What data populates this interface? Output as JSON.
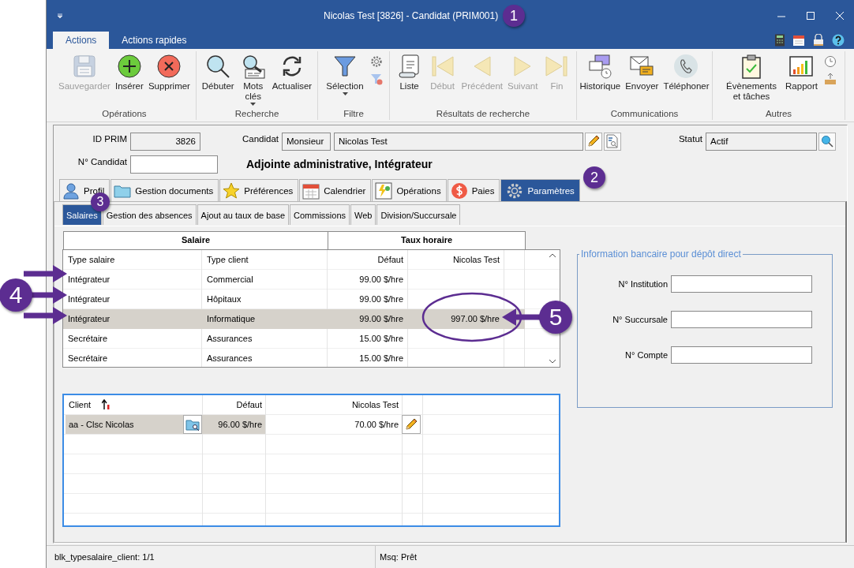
{
  "window": {
    "title": "Nicolas Test [3826] - Candidat (PRIM001)"
  },
  "ribbon": {
    "tabs": [
      {
        "label": "Actions",
        "selected": true
      },
      {
        "label": "Actions rapides",
        "selected": false
      }
    ],
    "groups": [
      {
        "label": "Opérations",
        "buttons": [
          {
            "label": "Sauvegarder",
            "disabled": true,
            "dropdown": false
          },
          {
            "label": "Insérer",
            "disabled": false,
            "dropdown": false
          },
          {
            "label": "Supprimer",
            "disabled": false,
            "dropdown": false
          }
        ]
      },
      {
        "label": "Recherche",
        "buttons": [
          {
            "label": "Débuter",
            "disabled": false,
            "dropdown": false
          },
          {
            "label": "Mots clés",
            "disabled": false,
            "dropdown": true
          },
          {
            "label": "Actualiser",
            "disabled": false,
            "dropdown": false
          }
        ]
      },
      {
        "label": "Filtre",
        "buttons": [
          {
            "label": "Sélection",
            "disabled": false,
            "dropdown": true
          }
        ]
      },
      {
        "label": "Résultats de recherche",
        "buttons": [
          {
            "label": "Liste",
            "disabled": false,
            "dropdown": false
          },
          {
            "label": "Début",
            "disabled": true,
            "dropdown": false
          },
          {
            "label": "Précédent",
            "disabled": true,
            "dropdown": false
          },
          {
            "label": "Suivant",
            "disabled": true,
            "dropdown": false
          },
          {
            "label": "Fin",
            "disabled": true,
            "dropdown": false
          }
        ]
      },
      {
        "label": "Communications",
        "buttons": [
          {
            "label": "Historique",
            "disabled": false,
            "dropdown": false
          },
          {
            "label": "Envoyer",
            "disabled": false,
            "dropdown": false
          },
          {
            "label": "Téléphoner",
            "disabled": false,
            "dropdown": false
          }
        ]
      },
      {
        "label": "Autres",
        "buttons": [
          {
            "label": "Évènements et tâches",
            "disabled": false,
            "dropdown": false
          },
          {
            "label": "Rapport",
            "disabled": false,
            "dropdown": false
          }
        ]
      }
    ]
  },
  "form": {
    "id_prim": {
      "label": "ID PRIM",
      "value": "3826"
    },
    "candidat": {
      "label": "Candidat",
      "title": "Monsieur",
      "name": "Nicolas Test"
    },
    "statut": {
      "label": "Statut",
      "value": "Actif"
    },
    "numero": {
      "label": "N° Candidat"
    },
    "heading": "Adjointe administrative, Intégrateur"
  },
  "tabs": [
    {
      "label": "Profil",
      "selected": false
    },
    {
      "label": "Gestion documents",
      "selected": false
    },
    {
      "label": "Préférences",
      "selected": false
    },
    {
      "label": "Calendrier",
      "selected": false
    },
    {
      "label": "Opérations",
      "selected": false
    },
    {
      "label": "Paies",
      "selected": false
    },
    {
      "label": "Paramètres",
      "selected": true
    }
  ],
  "subtabs": [
    {
      "label": "Salaires",
      "selected": true
    },
    {
      "label": "Gestion des absences",
      "selected": false
    },
    {
      "label": "Ajout au taux de base",
      "selected": false
    },
    {
      "label": "Commissions",
      "selected": false
    },
    {
      "label": "Web",
      "selected": false
    },
    {
      "label": "Division/Succursale",
      "selected": false
    }
  ],
  "salary_table": {
    "groups": [
      "Salaire",
      "Taux horaire"
    ],
    "columns": [
      "Type salaire",
      "Type client",
      "Défaut",
      "Nicolas Test"
    ],
    "rows": [
      {
        "type_salaire": "Intégrateur",
        "type_client": "Commercial",
        "defaut": "99.00 $/hre",
        "selected": false
      },
      {
        "type_salaire": "Intégrateur",
        "type_client": "Hôpitaux",
        "defaut": "99.00 $/hre",
        "selected": false
      },
      {
        "type_salaire": "Intégrateur",
        "type_client": "Informatique",
        "defaut": "99.00 $/hre",
        "nicolas_test": "997.00 $/hre",
        "selected": true
      },
      {
        "type_salaire": "Secrétaire",
        "type_client": "Assurances",
        "defaut": "15.00 $/hre",
        "selected": false
      },
      {
        "type_salaire": "Secrétaire",
        "type_client": "Assurances",
        "defaut": "15.00 $/hre",
        "selected": false
      }
    ]
  },
  "client_table": {
    "columns": [
      "Client",
      "Défaut",
      "Nicolas Test"
    ],
    "rows": [
      {
        "client": "aa - Clsc Nicolas",
        "defaut": "96.00 $/hre",
        "nicolas_test": "70.00 $/hre"
      }
    ]
  },
  "bank": {
    "title": "Information bancaire pour dépôt direct",
    "fields": [
      {
        "label": "N° Institution"
      },
      {
        "label": "N° Succursale"
      },
      {
        "label": "N° Compte"
      }
    ]
  },
  "status_bar": {
    "record": "blk_typesalaire_client: 1/1",
    "message": "Msq: Prêt"
  },
  "callouts": [
    "1",
    "2",
    "3",
    "4",
    "5"
  ]
}
